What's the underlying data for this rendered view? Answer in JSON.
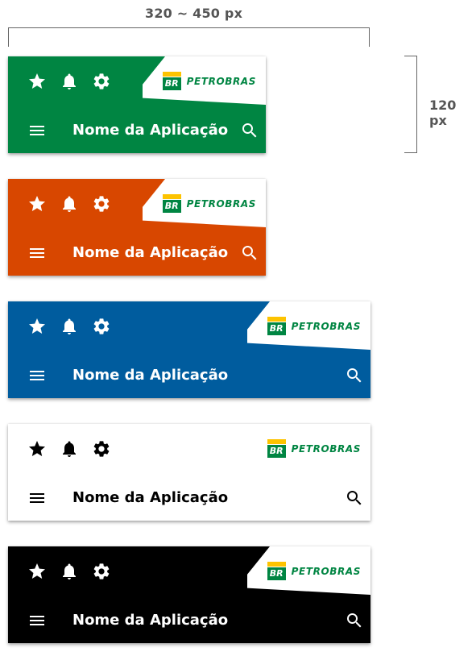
{
  "dimensions": {
    "width_label": "320 ~ 450 px",
    "height_label": "120 px"
  },
  "logo": {
    "mark_text": "BR",
    "wordmark": "PETROBRAS"
  },
  "app_bars": [
    {
      "variant": "green",
      "background": "#008542",
      "foreground": "#ffffff",
      "title": "Nome da Aplicação",
      "icons": [
        "star-icon",
        "bell-icon",
        "gear-icon",
        "menu-icon",
        "search-icon"
      ]
    },
    {
      "variant": "orange",
      "background": "#d84700",
      "foreground": "#ffffff",
      "title": "Nome da Aplicação",
      "icons": [
        "star-icon",
        "bell-icon",
        "gear-icon",
        "menu-icon",
        "search-icon"
      ]
    },
    {
      "variant": "blue",
      "background": "#005c9e",
      "foreground": "#ffffff",
      "title": "Nome da Aplicação",
      "icons": [
        "star-icon",
        "bell-icon",
        "gear-icon",
        "menu-icon",
        "search-icon"
      ]
    },
    {
      "variant": "white",
      "background": "#ffffff",
      "foreground": "#000000",
      "title": "Nome da Aplicação",
      "icons": [
        "star-icon",
        "bell-icon",
        "gear-icon",
        "menu-icon",
        "search-icon"
      ]
    },
    {
      "variant": "black",
      "background": "#000000",
      "foreground": "#ffffff",
      "title": "Nome da Aplicação",
      "icons": [
        "star-icon",
        "bell-icon",
        "gear-icon",
        "menu-icon",
        "search-icon"
      ]
    }
  ]
}
